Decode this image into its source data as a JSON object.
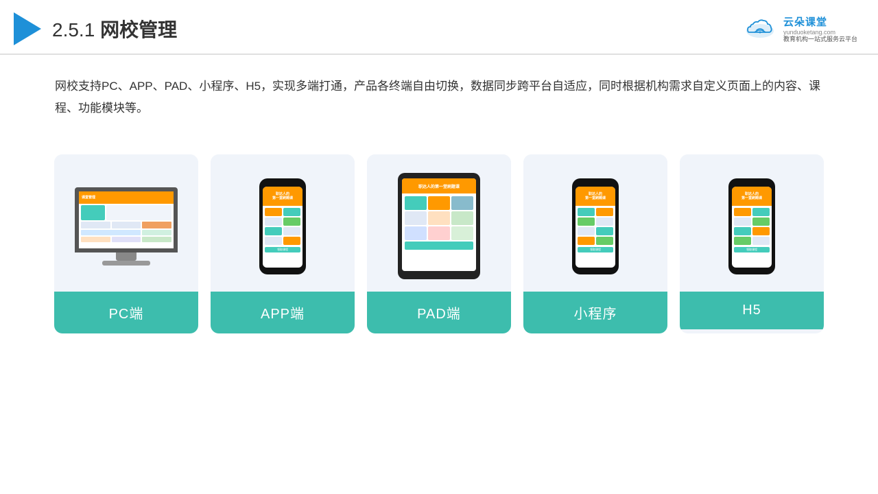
{
  "header": {
    "title": "2.5.1网校管理",
    "title_number": "2.5.1",
    "title_text": "网校管理"
  },
  "logo": {
    "name": "云朵课堂",
    "url": "yunduoketang.com",
    "tagline_line1": "教育机构一站",
    "tagline_line2": "式服务云平台"
  },
  "description": {
    "text": "网校支持PC、APP、PAD、小程序、H5，实现多端打通，产品各终端自由切换，数据同步跨平台自适应，同时根据机构需求自定义页面上的内容、课程、功能模块等。"
  },
  "cards": [
    {
      "id": "pc",
      "label": "PC端"
    },
    {
      "id": "app",
      "label": "APP端"
    },
    {
      "id": "pad",
      "label": "PAD端"
    },
    {
      "id": "miniprogram",
      "label": "小程序"
    },
    {
      "id": "h5",
      "label": "H5"
    }
  ],
  "accent_color": "#3dbdad",
  "header_color": "#1e90d8"
}
